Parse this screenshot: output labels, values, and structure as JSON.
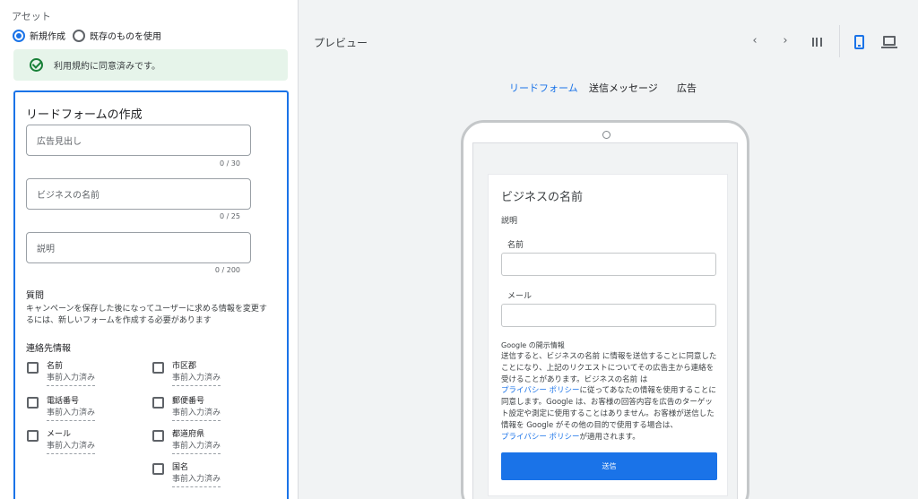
{
  "colors": {
    "accent": "#1a73e8",
    "success_bg": "#e6f4ea",
    "success_icon": "#188038"
  },
  "asset": {
    "label": "アセット",
    "radio_new": "新規作成",
    "radio_existing": "既存のものを使用",
    "terms_text": "利用規約に同意済みです。"
  },
  "form": {
    "title": "リードフォームの作成",
    "headline_placeholder": "広告見出し",
    "headline_counter": "0 / 30",
    "business_placeholder": "ビジネスの名前",
    "business_counter": "0 / 25",
    "description_placeholder": "説明",
    "description_counter": "0 / 200",
    "questions_title": "質問",
    "questions_note": "キャンペーンを保存した後になってユーザーに求める情報を変更するには、新しいフォームを作成する必要があります",
    "contact_title": "連絡先情報",
    "contact_items": [
      {
        "label": "名前",
        "sub": "事前入力済み"
      },
      {
        "label": "電話番号",
        "sub": "事前入力済み"
      },
      {
        "label": "メール",
        "sub": "事前入力済み"
      },
      {
        "label": "市区郡",
        "sub": "事前入力済み"
      },
      {
        "label": "郵便番号",
        "sub": "事前入力済み"
      },
      {
        "label": "都道府県",
        "sub": "事前入力済み"
      },
      {
        "label": "国名",
        "sub": "事前入力済み"
      }
    ]
  },
  "preview": {
    "title": "プレビュー",
    "toolbar": [
      "chevron-left-icon",
      "chevron-right-icon",
      "split-view-icon",
      "phone-icon",
      "laptop-icon"
    ],
    "tabs": [
      "リードフォーム",
      "送信メッセージ",
      "広告"
    ],
    "active_tab": "リードフォーム",
    "lead_form": {
      "business_name": "ビジネスの名前",
      "description": "説明",
      "name_label": "名前",
      "email_label": "メール",
      "disclosure_title": "Google の開示情報",
      "disclosure_1": "送信すると、ビジネスの名前 に情報を送信することに同意したことになり、上記のリクエストについてその広告主から連絡を受けることがあります。ビジネスの名前 は",
      "privacy_link_1": "プライバシー ポリシー",
      "disclosure_2": "に従ってあなたの情報を使用することに同意します。Google は、お客様の回答内容を広告のターゲット設定や測定に使用することはありません。お客様が送信した情報を Google がその他の目的で使用する場合は、",
      "privacy_link_2": "プライバシー ポリシー",
      "disclosure_3": "が適用されます。",
      "submit_label": "送信"
    }
  }
}
